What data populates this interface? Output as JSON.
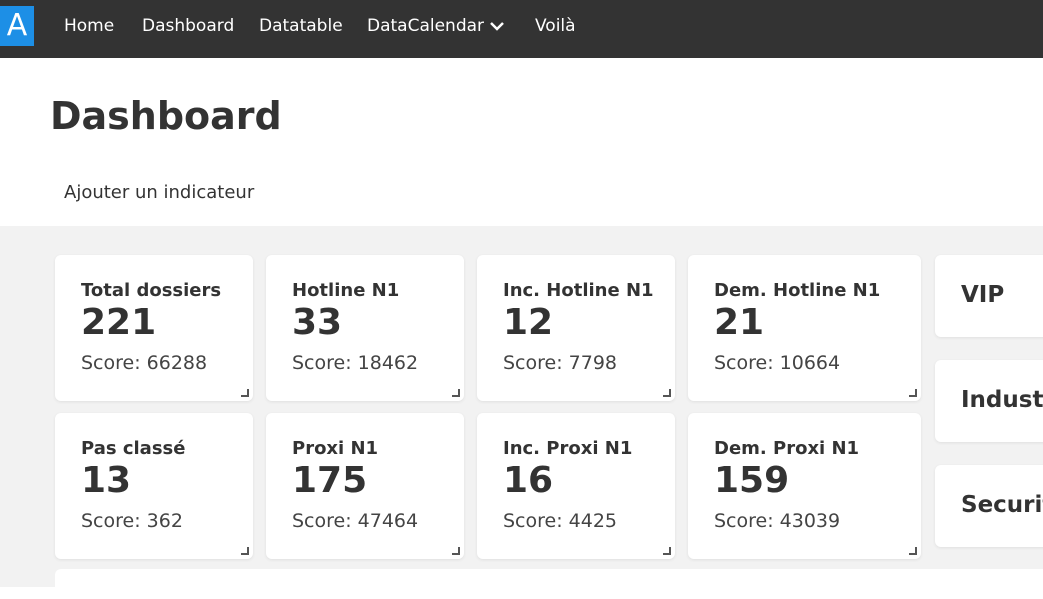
{
  "navbar": {
    "logo": "A",
    "items": [
      {
        "label": "Home"
      },
      {
        "label": "Dashboard"
      },
      {
        "label": "Datatable"
      },
      {
        "label": "DataCalendar"
      },
      {
        "label": "Voilà"
      }
    ]
  },
  "page": {
    "title": "Dashboard",
    "add_indicator": "Ajouter un indicateur"
  },
  "cards": [
    {
      "label": "Total dossiers",
      "value": "221",
      "score": "Score: 66288"
    },
    {
      "label": "Hotline N1",
      "value": "33",
      "score": "Score: 18462"
    },
    {
      "label": "Inc. Hotline N1",
      "value": "12",
      "score": "Score: 7798"
    },
    {
      "label": "Dem. Hotline N1",
      "value": "21",
      "score": "Score: 10664"
    },
    {
      "label": "Pas classé",
      "value": "13",
      "score": "Score: 362"
    },
    {
      "label": "Proxi N1",
      "value": "175",
      "score": "Score: 47464"
    },
    {
      "label": "Inc. Proxi N1",
      "value": "16",
      "score": "Score: 4425"
    },
    {
      "label": "Dem. Proxi N1",
      "value": "159",
      "score": "Score: 43039"
    }
  ],
  "side_cards": [
    {
      "label": "VIP"
    },
    {
      "label": "Industr"
    },
    {
      "label": "Securit"
    }
  ],
  "colors": {
    "navbar": "#333333",
    "logo": "#1d8fe6",
    "background": "#f2f2f2"
  }
}
